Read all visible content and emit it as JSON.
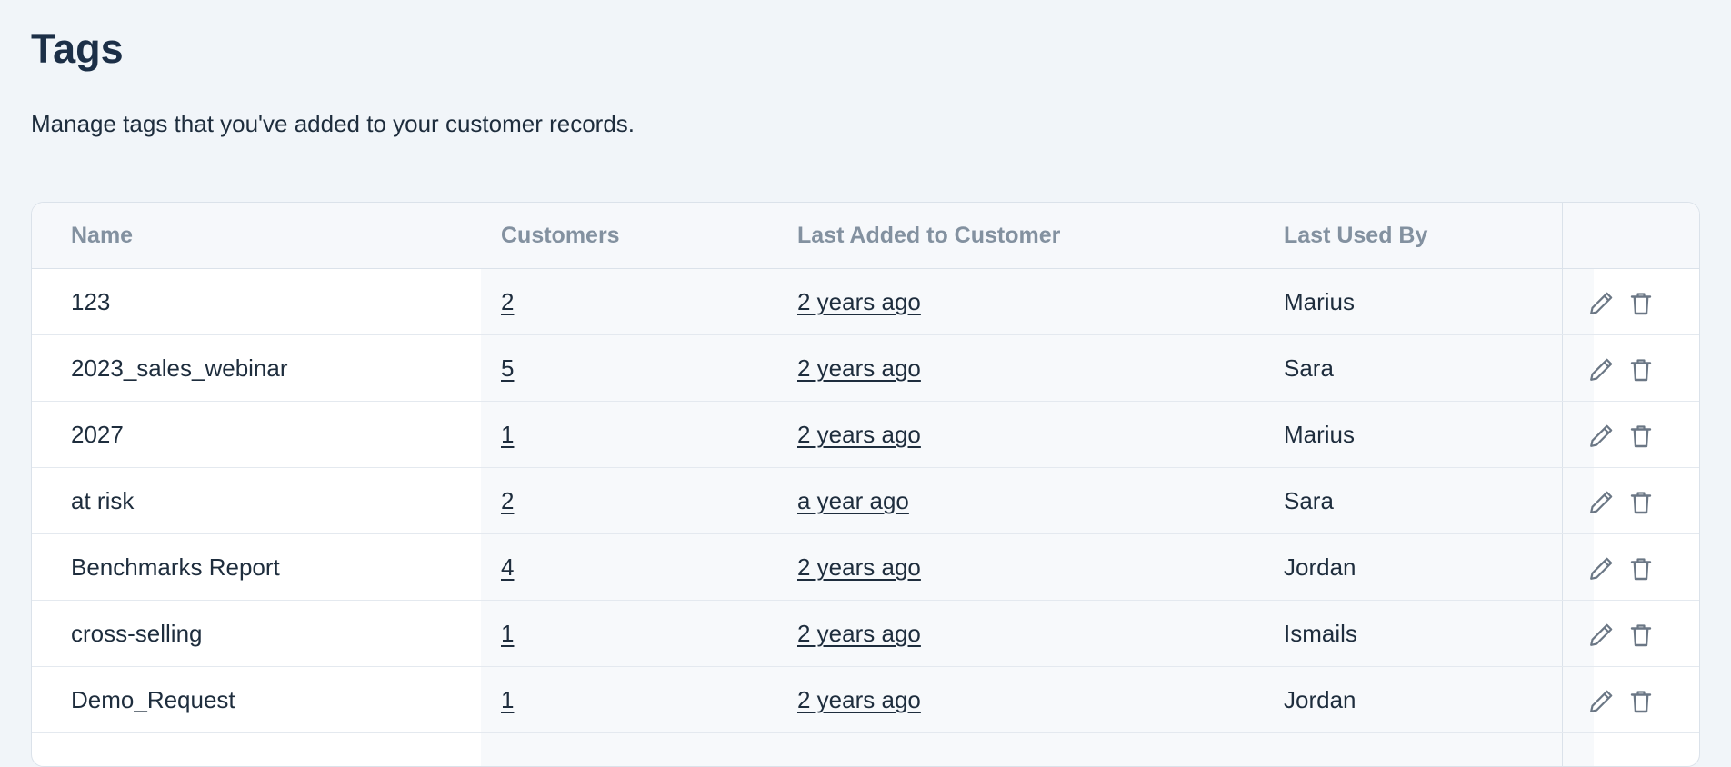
{
  "page": {
    "title": "Tags",
    "subtitle": "Manage tags that you've added to your customer records."
  },
  "table": {
    "columns": {
      "name": "Name",
      "customers": "Customers",
      "last_added": "Last Added to Customer",
      "last_used_by": "Last Used By"
    },
    "rows": [
      {
        "name": "123",
        "customers": "2",
        "last_added": "2 years ago",
        "last_used_by": "Marius"
      },
      {
        "name": "2023_sales_webinar",
        "customers": "5",
        "last_added": "2 years ago",
        "last_used_by": "Sara"
      },
      {
        "name": "2027",
        "customers": "1",
        "last_added": "2 years ago",
        "last_used_by": "Marius"
      },
      {
        "name": "at risk",
        "customers": "2",
        "last_added": "a year ago",
        "last_used_by": "Sara"
      },
      {
        "name": "Benchmarks Report",
        "customers": "4",
        "last_added": "2 years ago",
        "last_used_by": "Jordan"
      },
      {
        "name": "cross-selling",
        "customers": "1",
        "last_added": "2 years ago",
        "last_used_by": "Ismails"
      },
      {
        "name": "Demo_Request",
        "customers": "1",
        "last_added": "2 years ago",
        "last_used_by": "Jordan"
      }
    ],
    "row_actions": {
      "edit_icon": "pencil-icon",
      "delete_icon": "trash-icon"
    }
  },
  "colors": {
    "background": "#f1f5f9",
    "title": "#1c2f47",
    "header_text": "#8391a0",
    "icon": "#6b7785"
  }
}
